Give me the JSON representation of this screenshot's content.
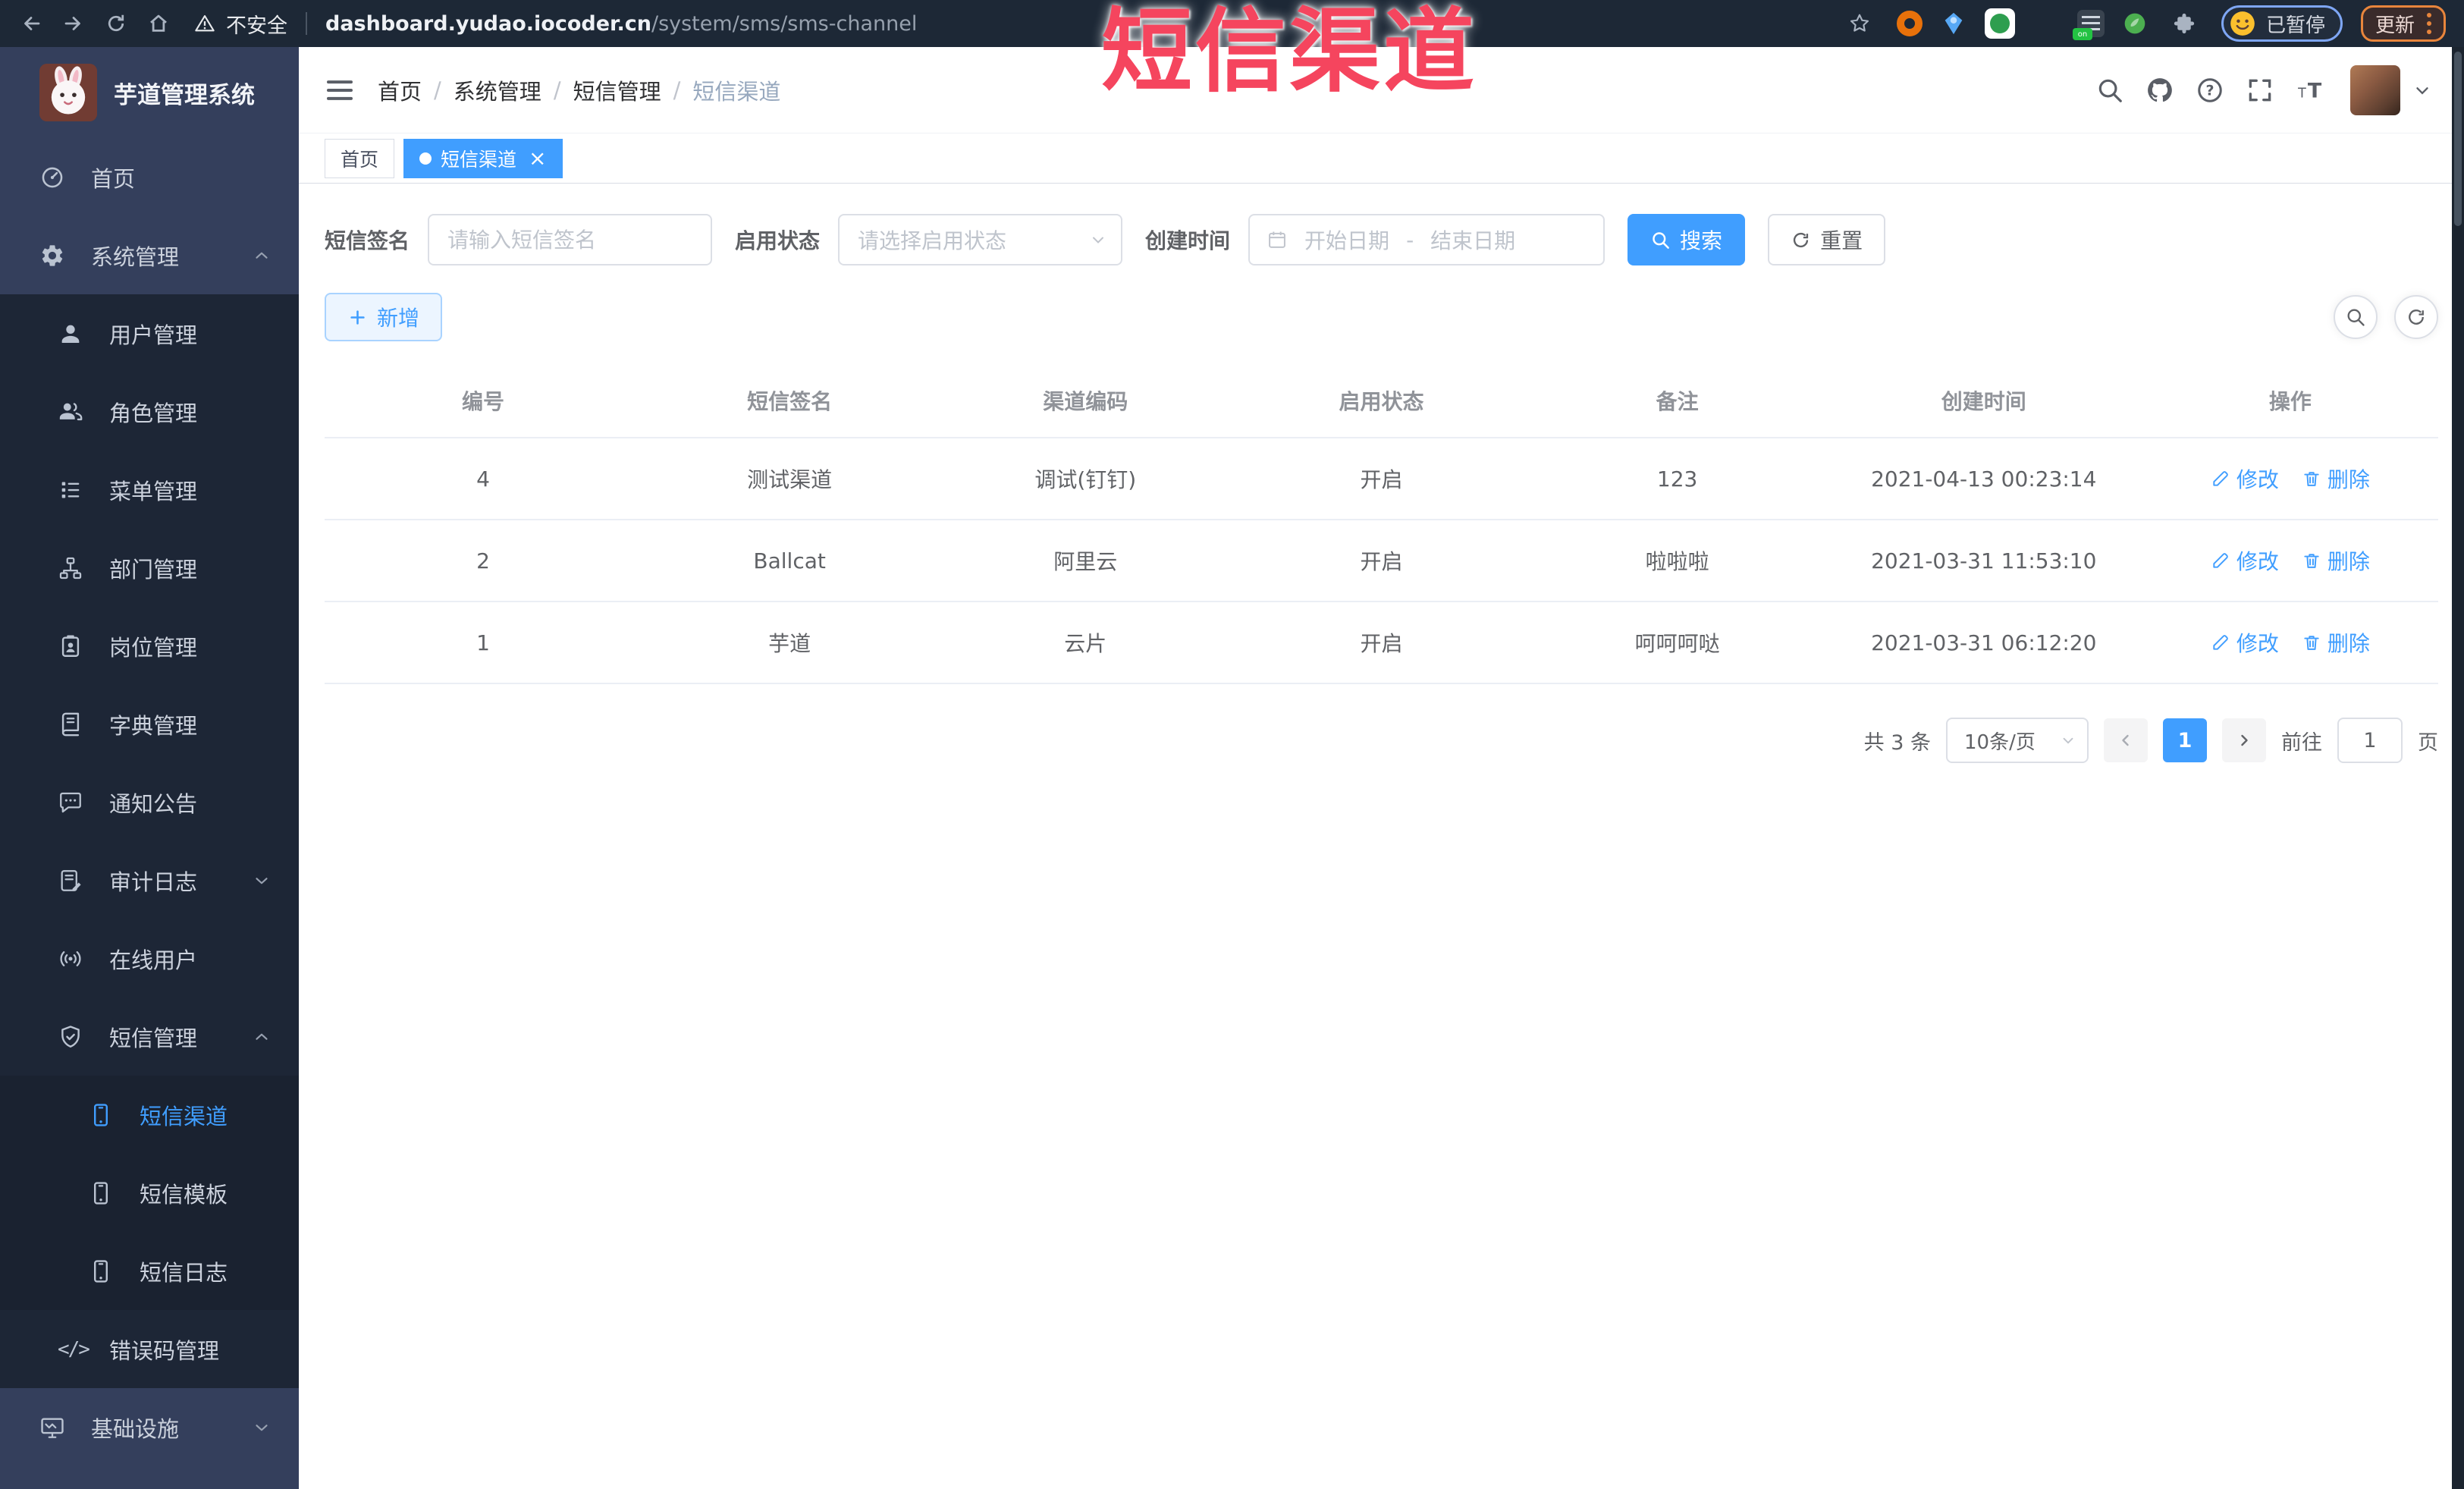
{
  "overlay": {
    "annotation": "短信渠道",
    "color": "#f5455e"
  },
  "browser": {
    "security_label": "不安全",
    "url_domain": "dashboard.yudao.iocoder.cn",
    "url_path": "/system/sms/sms-channel",
    "extension_badge": "on",
    "paused_label": "已暂停",
    "update_label": "更新"
  },
  "sidebar": {
    "logo_title": "芋道管理系统",
    "items": [
      {
        "key": "home",
        "label": "首页",
        "icon": "dashboard",
        "level": 1
      },
      {
        "key": "system",
        "label": "系统管理",
        "icon": "gear",
        "level": 1,
        "chevron": "up"
      },
      {
        "key": "user",
        "label": "用户管理",
        "icon": "user",
        "level": 2
      },
      {
        "key": "role",
        "label": "角色管理",
        "icon": "users",
        "level": 2
      },
      {
        "key": "menu",
        "label": "菜单管理",
        "icon": "menu-list",
        "level": 2
      },
      {
        "key": "dept",
        "label": "部门管理",
        "icon": "org-tree",
        "level": 2
      },
      {
        "key": "post",
        "label": "岗位管理",
        "icon": "id-badge",
        "level": 2
      },
      {
        "key": "dict",
        "label": "字典管理",
        "icon": "book",
        "level": 2
      },
      {
        "key": "notice",
        "label": "通知公告",
        "icon": "chat",
        "level": 2
      },
      {
        "key": "audit-log",
        "label": "审计日志",
        "icon": "log",
        "level": 2,
        "chevron": "down"
      },
      {
        "key": "online-user",
        "label": "在线用户",
        "icon": "online",
        "level": 2
      },
      {
        "key": "sms",
        "label": "短信管理",
        "icon": "shield",
        "level": 2,
        "chevron": "up"
      },
      {
        "key": "sms-channel",
        "label": "短信渠道",
        "icon": "phone",
        "level": 3,
        "active": true
      },
      {
        "key": "sms-template",
        "label": "短信模板",
        "icon": "phone",
        "level": 3
      },
      {
        "key": "sms-log",
        "label": "短信日志",
        "icon": "phone",
        "level": 3
      },
      {
        "key": "error-code",
        "label": "错误码管理",
        "icon": "code",
        "level": 2
      },
      {
        "key": "infra",
        "label": "基础设施",
        "icon": "monitor",
        "level": 1,
        "chevron": "down"
      }
    ]
  },
  "header": {
    "breadcrumb": [
      "首页",
      "系统管理",
      "短信管理",
      "短信渠道"
    ]
  },
  "tabs": [
    {
      "label": "首页",
      "active": false
    },
    {
      "label": "短信渠道",
      "active": true,
      "closable": true
    }
  ],
  "filters": {
    "sign_label": "短信签名",
    "sign_placeholder": "请输入短信签名",
    "status_label": "启用状态",
    "status_placeholder": "请选择启用状态",
    "date_label": "创建时间",
    "date_start_placeholder": "开始日期",
    "date_separator": "-",
    "date_end_placeholder": "结束日期",
    "search_label": "搜索",
    "reset_label": "重置"
  },
  "toolbar": {
    "add_label": "新增"
  },
  "table": {
    "columns": [
      "编号",
      "短信签名",
      "渠道编码",
      "启用状态",
      "备注",
      "创建时间",
      "操作"
    ],
    "op_edit": "修改",
    "op_delete": "删除",
    "rows": [
      {
        "id": "4",
        "sign": "测试渠道",
        "code": "调试(钉钉)",
        "status": "开启",
        "remark": "123",
        "created": "2021-04-13 00:23:14"
      },
      {
        "id": "2",
        "sign": "Ballcat",
        "code": "阿里云",
        "status": "开启",
        "remark": "啦啦啦",
        "created": "2021-03-31 11:53:10"
      },
      {
        "id": "1",
        "sign": "芋道",
        "code": "云片",
        "status": "开启",
        "remark": "呵呵呵哒",
        "created": "2021-03-31 06:12:20"
      }
    ]
  },
  "pagination": {
    "total_label": "共 3 条",
    "page_size": "10条/页",
    "current_page": "1",
    "goto_label": "前往",
    "goto_value": "1",
    "page_label": "页"
  },
  "colors": {
    "accent": "#409eff",
    "active_tab": "#409eff",
    "annotation": "#f5455e",
    "sidebar_dark": "#1d2636",
    "sidebar_light": "#343f5c"
  }
}
